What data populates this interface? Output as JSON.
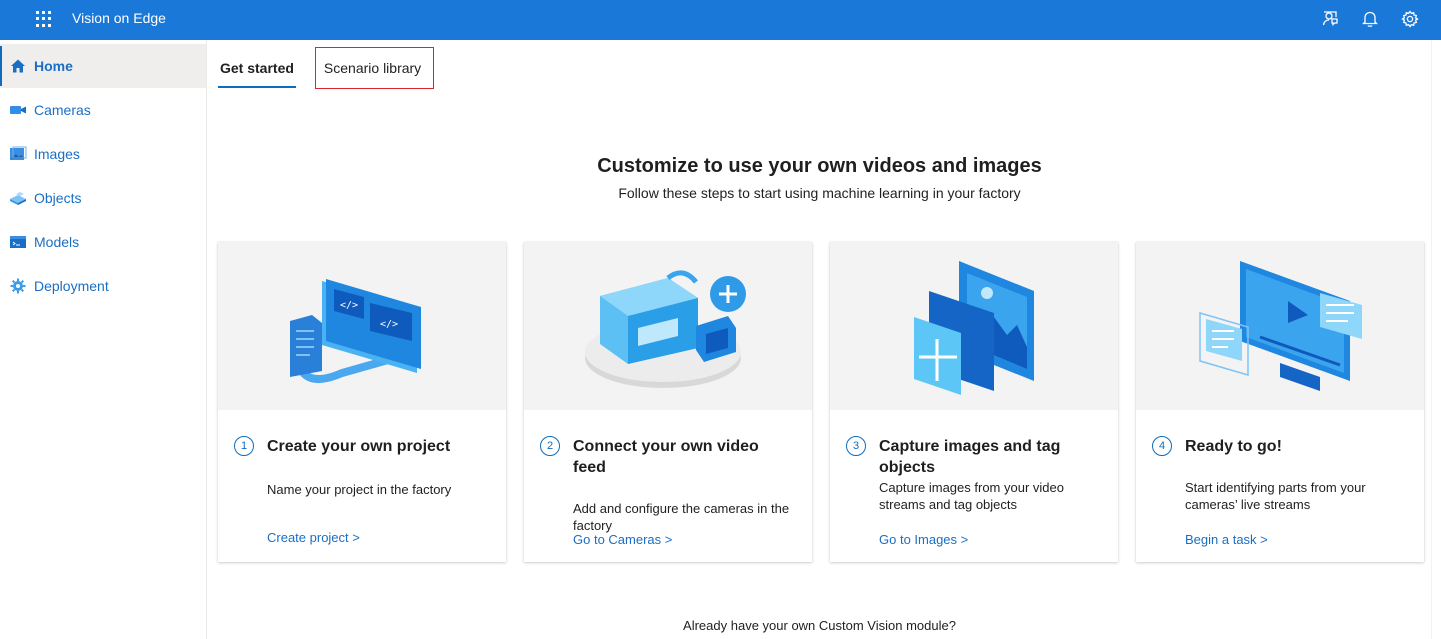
{
  "header": {
    "app_title": "Vision on Edge",
    "icons": [
      "waffle-icon",
      "feedback-icon",
      "bell-icon",
      "gear-icon"
    ],
    "accent_color": "#1a78d9"
  },
  "sidebar": {
    "items": [
      {
        "label": "Home",
        "icon": "home-icon",
        "active": true
      },
      {
        "label": "Cameras",
        "icon": "camera-icon"
      },
      {
        "label": "Images",
        "icon": "images-icon"
      },
      {
        "label": "Objects",
        "icon": "objects-icon"
      },
      {
        "label": "Models",
        "icon": "models-icon"
      },
      {
        "label": "Deployment",
        "icon": "deployment-icon"
      }
    ]
  },
  "tabs": [
    {
      "label": "Get started",
      "active": true
    },
    {
      "label": "Scenario library",
      "active": false
    }
  ],
  "hero": {
    "title": "Customize to use your own videos and images",
    "subtitle": "Follow these steps to start using machine learning in your factory"
  },
  "cards": [
    {
      "step": "1",
      "title": "Create your own project",
      "description": "Name your project in the factory",
      "link": "Create project >"
    },
    {
      "step": "2",
      "title": "Connect your own video feed",
      "description": "Add and configure the cameras in the factory",
      "link": "Go to Cameras >"
    },
    {
      "step": "3",
      "title": "Capture images and tag objects",
      "description": "Capture images from your video streams and tag objects",
      "link": "Go to Images >"
    },
    {
      "step": "4",
      "title": "Ready to go!",
      "description": "Start identifying parts from your cameras’ live streams",
      "link": "Begin a task >"
    }
  ],
  "footer": {
    "note": "Already have your own Custom Vision module?"
  }
}
